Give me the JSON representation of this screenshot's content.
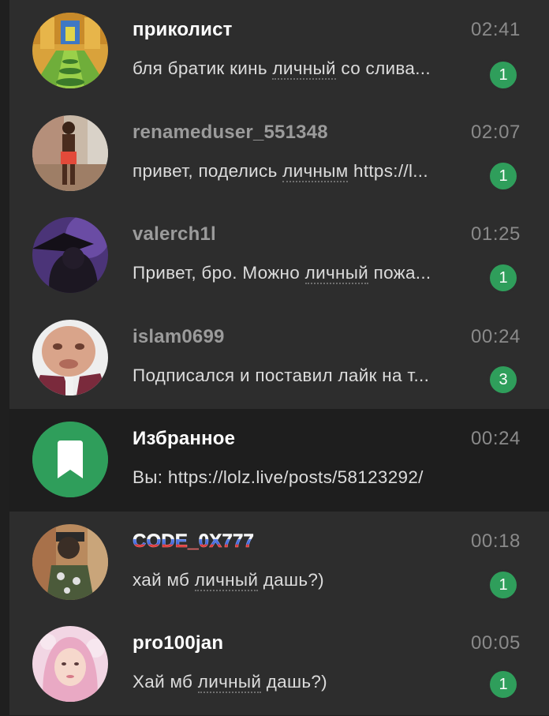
{
  "chats": [
    {
      "name": "приколист",
      "time": "02:41",
      "preview_a": "бля братик кинь ",
      "preview_hl": "личный",
      "preview_b": " со слива...",
      "unread": "1"
    },
    {
      "name": "renameduser_551348",
      "time": "02:07",
      "preview_a": "привет, поделись ",
      "preview_hl": "личным",
      "preview_b": " https://l...",
      "unread": "1"
    },
    {
      "name": "valerch1l",
      "time": "01:25",
      "preview_a": "Привет, бро. Можно ",
      "preview_hl": "личный",
      "preview_b": " пожа...",
      "unread": "1"
    },
    {
      "name": "islam0699",
      "time": "00:24",
      "preview_a": "Подписался и поставил лайк на т...",
      "preview_hl": "",
      "preview_b": "",
      "unread": "3"
    },
    {
      "name": "Избранное",
      "time": "00:24",
      "preview_a": "Вы: https://lolz.live/posts/58123292/",
      "preview_hl": "",
      "preview_b": "",
      "unread": ""
    },
    {
      "name": "CODE_0X777",
      "time": "00:18",
      "preview_a": "хай мб ",
      "preview_hl": "личный",
      "preview_b": " дашь?)",
      "unread": "1"
    },
    {
      "name": "pro100jan",
      "time": "00:05",
      "preview_a": "Хай мб ",
      "preview_hl": "личный",
      "preview_b": " дашь?)",
      "unread": "1"
    }
  ],
  "colors": {
    "badge": "#2f9e5b",
    "saved_avatar": "#2f9e5b",
    "selected_row": "#1e1e1e",
    "list_bg": "#2d2d2d"
  },
  "icons": {
    "saved_messages": "bookmark-icon"
  }
}
